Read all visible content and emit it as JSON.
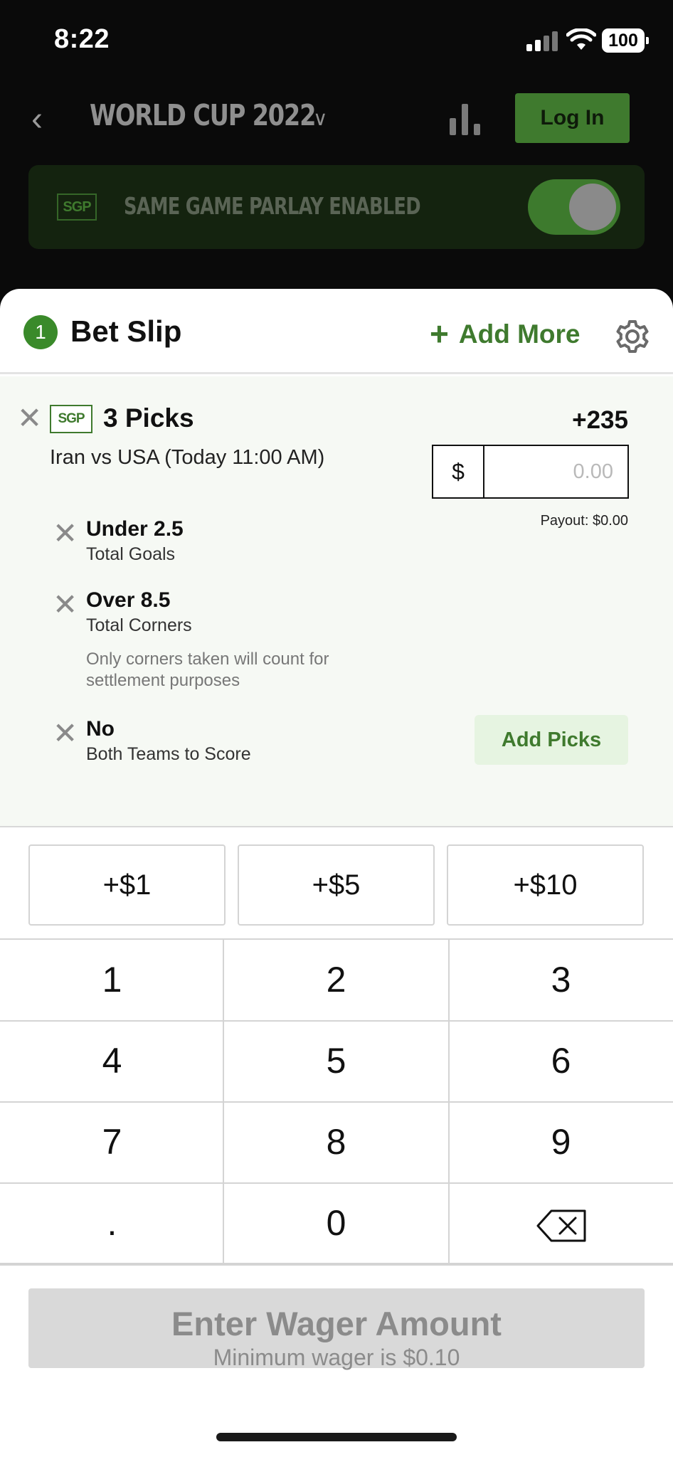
{
  "status_bar": {
    "time": "8:22",
    "battery": "100"
  },
  "topbar": {
    "title": "WORLD CUP 2022",
    "login_label": "Log In"
  },
  "sgp_banner": {
    "badge": "SGP",
    "text": "SAME GAME PARLAY ENABLED",
    "toggle_on": true
  },
  "bet_slip": {
    "count": "1",
    "title": "Bet Slip",
    "add_more_label": "Add More",
    "parlay": {
      "badge": "SGP",
      "title": "3 Picks",
      "odds": "+235",
      "match": "Iran vs USA (Today 11:00 AM)",
      "currency": "$",
      "wager_placeholder": "0.00",
      "payout": "Payout: $0.00",
      "legs": [
        {
          "selection": "Under 2.5",
          "market": "Total Goals",
          "note": ""
        },
        {
          "selection": "Over 8.5",
          "market": "Total Corners",
          "note": "Only corners taken will count for settlement purposes"
        },
        {
          "selection": "No",
          "market": "Both Teams to Score",
          "note": ""
        }
      ],
      "add_picks_label": "Add Picks"
    }
  },
  "quick_amounts": [
    "+$1",
    "+$5",
    "+$10"
  ],
  "keypad": [
    "1",
    "2",
    "3",
    "4",
    "5",
    "6",
    "7",
    "8",
    "9",
    ".",
    "0"
  ],
  "cta": {
    "title": "Enter Wager Amount",
    "subtitle": "Minimum wager is $0.10"
  },
  "colors": {
    "accent": "#3f7a2e",
    "background": "#0a0a0a",
    "card": "#f6f9f4"
  }
}
